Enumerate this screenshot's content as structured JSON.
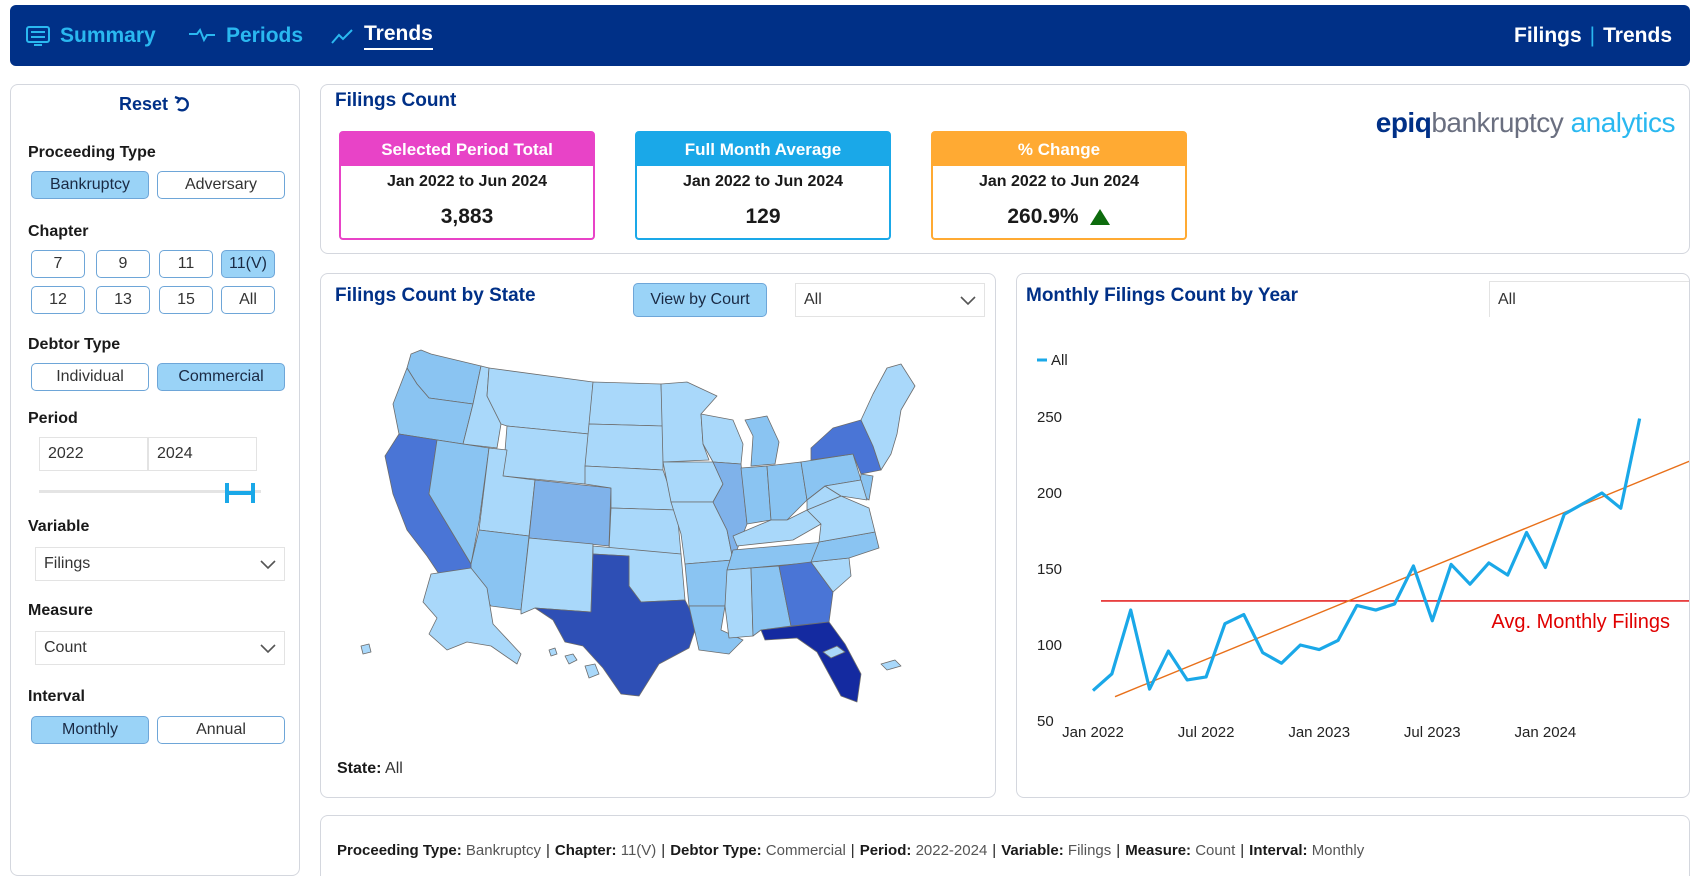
{
  "nav": {
    "tabs": [
      {
        "label": "Summary",
        "icon": "list-icon"
      },
      {
        "label": "Periods",
        "icon": "periods-icon"
      },
      {
        "label": "Trends",
        "icon": "trend-icon",
        "active": true
      }
    ],
    "right_primary": "Filings",
    "right_separator": "|",
    "right_secondary": "Trends"
  },
  "sidebar": {
    "reset_label": "Reset",
    "proceeding_type": {
      "label": "Proceeding Type",
      "options": [
        "Bankruptcy",
        "Adversary"
      ],
      "selected": "Bankruptcy"
    },
    "chapter": {
      "label": "Chapter",
      "options": [
        "7",
        "9",
        "11",
        "11(V)",
        "12",
        "13",
        "15",
        "All"
      ],
      "selected": "11(V)"
    },
    "debtor_type": {
      "label": "Debtor Type",
      "options": [
        "Individual",
        "Commercial"
      ],
      "selected": "Commercial"
    },
    "period": {
      "label": "Period",
      "from": "2022",
      "to": "2024"
    },
    "variable": {
      "label": "Variable",
      "value": "Filings"
    },
    "measure": {
      "label": "Measure",
      "value": "Count"
    },
    "interval": {
      "label": "Interval",
      "options": [
        "Monthly",
        "Annual"
      ],
      "selected": "Monthly"
    }
  },
  "summary": {
    "title": "Filings Count",
    "cards": [
      {
        "title": "Selected Period Total",
        "range": "Jan 2022 to Jun 2024",
        "value": "3,883",
        "color": "#e843c7"
      },
      {
        "title": "Full Month Average",
        "range": "Jan 2022 to Jun 2024",
        "value": "129",
        "color": "#1aa8e8"
      },
      {
        "title": "% Change",
        "range": "Jan 2022 to Jun 2024",
        "value": "260.9%",
        "color": "#ffaa33",
        "trend": "up"
      }
    ],
    "logo": {
      "part1": "epiq",
      "part2": "bankruptcy",
      "part3": "analytics"
    }
  },
  "map": {
    "title": "Filings Count by State",
    "view_button": "View by Court",
    "state_select": "All",
    "state_label": "State:",
    "state_value": "All",
    "colors": {
      "light": "#a9d8fa",
      "mid": "#8ac4f2",
      "medium": "#7fb2ea",
      "dark": "#4a75d6",
      "darker": "#2e4fb5",
      "darkest": "#142aa0"
    }
  },
  "trend": {
    "title": "Monthly Filings Count by Year",
    "year_select": "All",
    "avg_label": "Avg. Monthly Filings"
  },
  "chart_data": {
    "type": "line",
    "title": "Monthly Filings Count by Year",
    "legend": "top-left",
    "series": [
      {
        "name": "All",
        "color": "#1aa8e8",
        "values": [
          70,
          81,
          123,
          71,
          96,
          77,
          79,
          114,
          120,
          95,
          88,
          100,
          97,
          103,
          126,
          123,
          127,
          152,
          116,
          153,
          140,
          154,
          146,
          174,
          151,
          186,
          193,
          200,
          190,
          249
        ]
      }
    ],
    "x": [
      "Jan 2022",
      "Feb 2022",
      "Mar 2022",
      "Apr 2022",
      "May 2022",
      "Jun 2022",
      "Jul 2022",
      "Aug 2022",
      "Sep 2022",
      "Oct 2022",
      "Nov 2022",
      "Dec 2022",
      "Jan 2023",
      "Feb 2023",
      "Mar 2023",
      "Apr 2023",
      "May 2023",
      "Jun 2023",
      "Jul 2023",
      "Aug 2023",
      "Sep 2023",
      "Oct 2023",
      "Nov 2023",
      "Dec 2023",
      "Jan 2024",
      "Feb 2024",
      "Mar 2024",
      "Apr 2024",
      "May 2024",
      "Jun 2024"
    ],
    "x_tick_labels": [
      "Jan 2022",
      "Jul 2022",
      "Jan 2023",
      "Jul 2023",
      "Jan 2024"
    ],
    "y_ticks": [
      50,
      100,
      150,
      200,
      250
    ],
    "ylim": [
      50,
      250
    ],
    "average_line": {
      "value": 129,
      "label": "Avg. Monthly Filings",
      "color": "#e00000"
    },
    "trend_line": {
      "start": 66,
      "end": 223,
      "color": "#e8701a"
    }
  },
  "footer": {
    "items": [
      {
        "label": "Proceeding Type:",
        "value": "Bankruptcy"
      },
      {
        "label": "Chapter:",
        "value": "11(V)"
      },
      {
        "label": "Debtor Type:",
        "value": "Commercial"
      },
      {
        "label": "Period:",
        "value": "2022-2024"
      },
      {
        "label": "Variable:",
        "value": "Filings"
      },
      {
        "label": "Measure:",
        "value": "Count"
      },
      {
        "label": "Interval:",
        "value": "Monthly"
      }
    ]
  }
}
